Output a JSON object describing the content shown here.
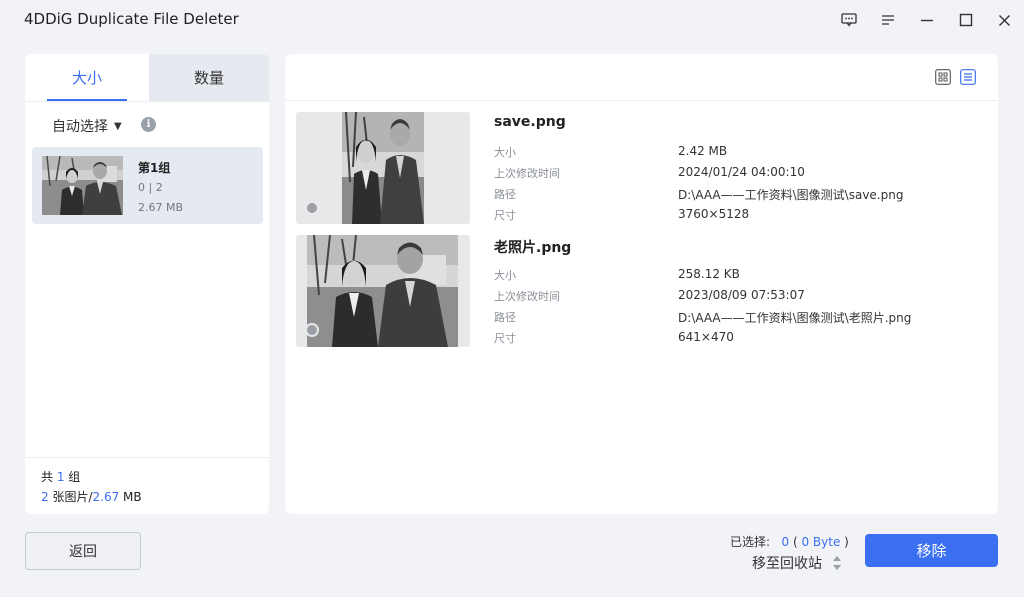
{
  "app": {
    "title": "4DDiG Duplicate File Deleter"
  },
  "window_controls": [
    "feedback-icon",
    "menu-icon",
    "minimize-icon",
    "maximize-icon",
    "close-icon"
  ],
  "tabs": [
    {
      "label": "大小",
      "active": true
    },
    {
      "label": "数量",
      "active": false
    }
  ],
  "auto_select": {
    "label": "自动选择"
  },
  "groups": [
    {
      "name": "第1组",
      "selected": "0 | 2",
      "size": "2.67 MB"
    }
  ],
  "summary": {
    "prefix": "共 ",
    "group_count": "1",
    "group_suffix": " 组",
    "image_count": "2",
    "image_mid": " 张图片/",
    "total_size": "2.67",
    "size_suffix": " MB"
  },
  "meta_labels": {
    "size": "大小",
    "modified": "上次修改时间",
    "path": "路径",
    "dimensions": "尺寸"
  },
  "files": [
    {
      "name": "save.png",
      "size": "2.42 MB",
      "modified": "2024/01/24 04:00:10",
      "path": "D:\\AAA——工作资料\\图像测试\\save.png",
      "dimensions": "3760×5128"
    },
    {
      "name": "老照片.png",
      "size": "258.12 KB",
      "modified": "2023/08/09 07:53:07",
      "path": "D:\\AAA——工作资料\\图像测试\\老照片.png",
      "dimensions": "641×470"
    }
  ],
  "footer": {
    "back_label": "返回",
    "selected_label": "已选择:",
    "selected_count": "0",
    "selected_size": "0 Byte",
    "recycle_label": "移至回收站",
    "remove_label": "移除"
  },
  "colors": {
    "accent": "#3a6ff2",
    "background": "#f1f3f7",
    "selected_row": "#e5e9f2"
  }
}
